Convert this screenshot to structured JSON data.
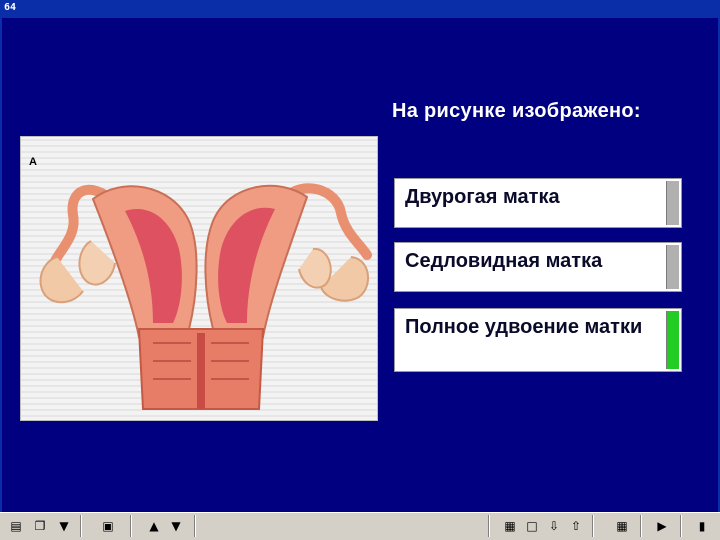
{
  "window": {
    "title": "64"
  },
  "question": {
    "text": "На рисунке изображено:"
  },
  "figure": {
    "label": "А"
  },
  "answers": [
    {
      "label": "Двурогая матка",
      "status_color": "#b0b0b0"
    },
    {
      "label": "Седловидная матка",
      "status_color": "#b0b0b0"
    },
    {
      "label": "Полное удвоение матки",
      "status_color": "#22cc22"
    }
  ],
  "toolbar": {
    "icons": [
      "notes-icon",
      "copy-icon",
      "save-icon",
      "print-icon",
      "arrow-up-icon",
      "arrow-down-icon",
      "picture-icon",
      "window-icon",
      "export-icon",
      "import-icon",
      "calendar-icon",
      "play-icon",
      "exit-icon"
    ]
  },
  "colors": {
    "background": "#000080",
    "correct": "#22cc22",
    "neutral": "#b0b0b0"
  }
}
